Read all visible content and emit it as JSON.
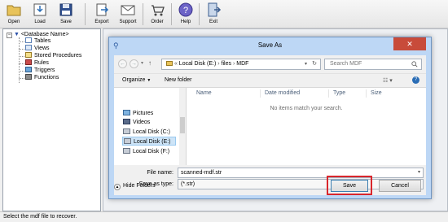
{
  "toolbar": {
    "buttons": [
      {
        "label": "Open"
      },
      {
        "label": "Load"
      },
      {
        "label": "Save"
      },
      {
        "label": "Export"
      },
      {
        "label": "Support"
      },
      {
        "label": "Order"
      },
      {
        "label": "Help"
      },
      {
        "label": "Exit"
      }
    ]
  },
  "tree": {
    "root": "<Database Name>",
    "items": [
      "Tables",
      "Views",
      "Stored Procedures",
      "Rules",
      "Triggers",
      "Functions"
    ]
  },
  "status": {
    "text": "Select the mdf file to recover."
  },
  "dialog": {
    "title": "Save As",
    "address": {
      "path": [
        "Local Disk (E:)",
        "files",
        "MDF"
      ],
      "search_placeholder": "Search MDF"
    },
    "commands": {
      "organize": "Organize",
      "new_folder": "New folder"
    },
    "nav": {
      "items": [
        {
          "label": "Pictures",
          "selected": false
        },
        {
          "label": "Videos",
          "selected": false
        },
        {
          "label": "Local Disk (C:)",
          "selected": false
        },
        {
          "label": "Local Disk (E:)",
          "selected": true
        },
        {
          "label": "Local Disk (F:)",
          "selected": false
        }
      ]
    },
    "columns": [
      "Name",
      "Date modified",
      "Type",
      "Size"
    ],
    "empty_message": "No items match your search.",
    "file_name_label": "File name:",
    "file_name_value": "scanned-mdf.str",
    "save_type_label": "Save as type:",
    "save_type_value": "(*.str)",
    "hide_folders": "Hide Folders",
    "save_button": "Save",
    "cancel_button": "Cancel"
  },
  "colors": {
    "highlight": "#d9262c",
    "titlebar": "#bdd7f5",
    "close": "#c84b3a"
  }
}
